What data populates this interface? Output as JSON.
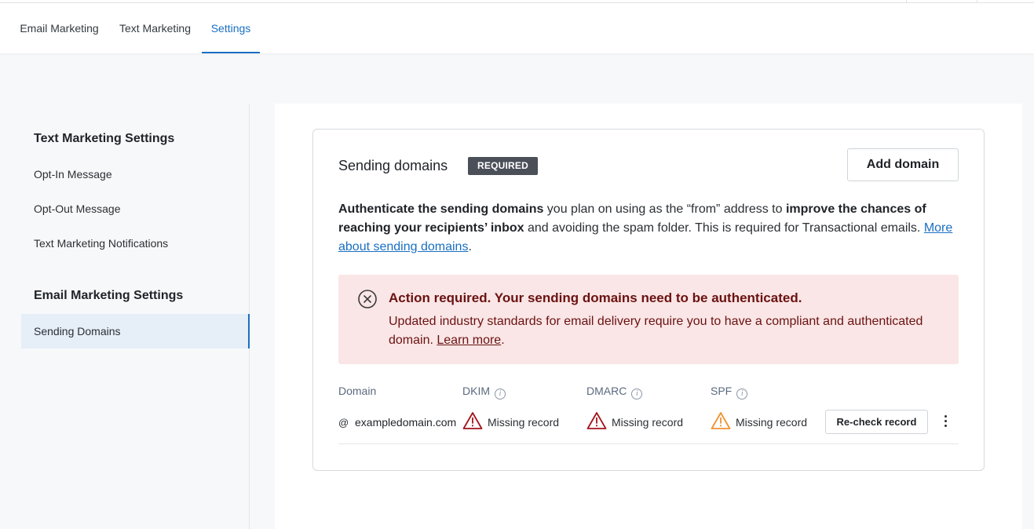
{
  "tabs": {
    "email": "Email Marketing",
    "text": "Text Marketing",
    "settings": "Settings"
  },
  "sidebar": {
    "text_heading": "Text Marketing Settings",
    "text_items": [
      "Opt-In Message",
      "Opt-Out Message",
      "Text Marketing Notifications"
    ],
    "email_heading": "Email Marketing Settings",
    "email_items": [
      "Sending Domains"
    ]
  },
  "card": {
    "title": "Sending domains",
    "badge": "REQUIRED",
    "add_button": "Add domain",
    "desc": {
      "b1": "Authenticate the sending domains",
      "t1": " you plan on using as the “from” address to ",
      "b2": "improve the chances of reaching your recipients’ inbox",
      "t2": " and avoiding the spam folder. This is required for Transactional emails. ",
      "link": "More about sending domains",
      "t3": "."
    },
    "alert": {
      "icon": "x-circle-icon",
      "title": "Action required. Your sending domains need to be authenticated.",
      "body": "Updated industry standards for email delivery require you to have a compliant and authenticated domain. ",
      "link": "Learn more",
      "end": "."
    },
    "table": {
      "headers": {
        "domain": "Domain",
        "dkim": "DKIM",
        "dmarc": "DMARC",
        "spf": "SPF"
      },
      "info_glyph": "i",
      "row": {
        "at": "@",
        "domain": "exampledomain.com",
        "dkim": "Missing record",
        "dmarc": "Missing record",
        "spf": "Missing record",
        "recheck": "Re-check record"
      }
    }
  },
  "colors": {
    "accent": "#1a6fc2",
    "error": "#a3141c",
    "warning": "#f0922e",
    "alert_bg": "#fae6e6"
  }
}
